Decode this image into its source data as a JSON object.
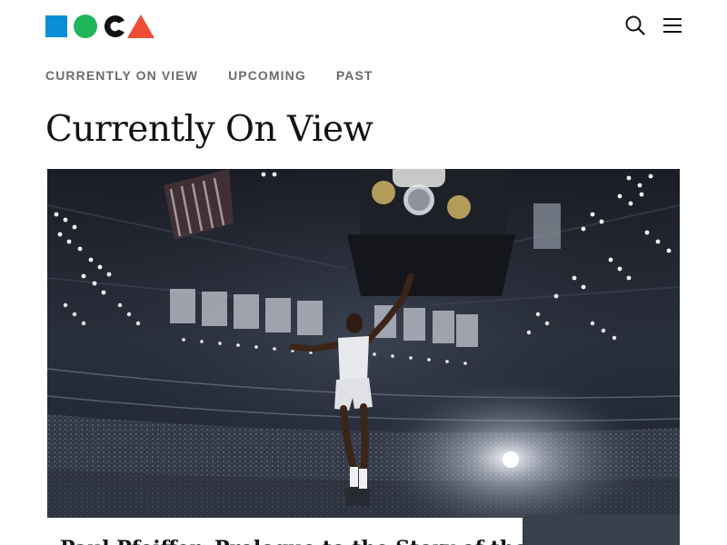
{
  "brand": {
    "name": "MOCA",
    "colors": {
      "blue": "#0a8fd6",
      "green": "#1fb65b",
      "black": "#111111",
      "red": "#ef4c36"
    }
  },
  "header": {
    "search_icon": "search-icon",
    "menu_icon": "hamburger-menu-icon"
  },
  "subnav": {
    "items": [
      {
        "label": "CURRENTLY ON VIEW"
      },
      {
        "label": "UPCOMING"
      },
      {
        "label": "PAST"
      }
    ]
  },
  "main": {
    "title": "Currently On View",
    "featured": {
      "title": "Paul Pfeiffer: Prologue to the Story of the Birth of Freedom"
    }
  }
}
